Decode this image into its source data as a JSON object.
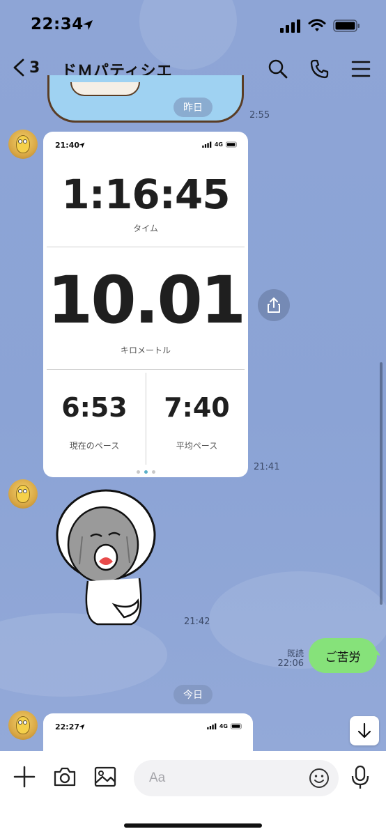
{
  "status_bar": {
    "time": "22:34"
  },
  "nav": {
    "back_count": "3",
    "title": "ドＭパティシエ"
  },
  "date_separators": {
    "yesterday": "昨日",
    "today": "今日"
  },
  "messages": {
    "sticker1_time": "2:55",
    "screenshot_time": "21:41",
    "sticker2_time": "21:42",
    "my_message": {
      "text": "ご苦労",
      "read_label": "既読",
      "time": "22:06"
    }
  },
  "screenshot": {
    "status_time": "21:40",
    "network": "4G",
    "time_value": "1:16:45",
    "time_label": "タイム",
    "distance_value": "10.01",
    "distance_label": "キロメートル",
    "current_pace_value": "6:53",
    "current_pace_label": "現在のペース",
    "avg_pace_value": "7:40",
    "avg_pace_label": "平均ペース"
  },
  "screenshot2": {
    "status_time": "22:27",
    "network": "4G"
  },
  "input": {
    "placeholder": "Aa"
  },
  "colors": {
    "chat_bg": "#8fa6d6",
    "my_bubble": "#86e27a",
    "active_dot": "#5ab0c9"
  }
}
